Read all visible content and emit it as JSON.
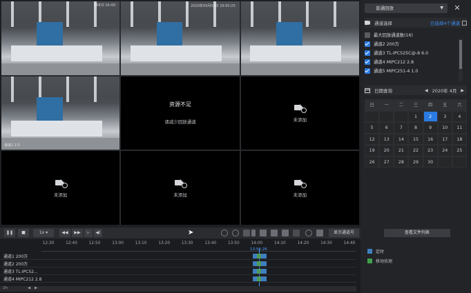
{
  "cells": [
    {
      "type": "video",
      "osd": "TRE/S 16:4D"
    },
    {
      "type": "video",
      "osd": "2020年04月02日 16:50:25"
    },
    {
      "type": "video",
      "osd": ""
    },
    {
      "type": "video",
      "stamp": "通道2 2.0"
    },
    {
      "type": "message",
      "title": "资源不足",
      "text": "请减少回放通道"
    },
    {
      "type": "empty",
      "text": "未添加"
    },
    {
      "type": "empty",
      "text": "未添加"
    },
    {
      "type": "empty",
      "text": "未添加"
    },
    {
      "type": "empty",
      "text": "未添加"
    }
  ],
  "side": {
    "mode_select": "普通回放",
    "channel_header": "通道选择",
    "selected_count": "已选择4个通道",
    "channels": [
      {
        "label": "最大回放通道数(16)",
        "checked": false
      },
      {
        "label": "通道2 200万",
        "checked": true
      },
      {
        "label": "通道3 TL-IPC525C@-8 6.0",
        "checked": true
      },
      {
        "label": "通道4 MIPC212 2.8",
        "checked": true
      },
      {
        "label": "通道5 MIPC251-4 1.0",
        "checked": true
      }
    ],
    "date_header": "日期查询",
    "month": "2020年 4月",
    "weekdays": [
      "日",
      "一",
      "二",
      "三",
      "四",
      "五",
      "六"
    ],
    "calendar": [
      [
        "",
        "",
        "",
        "1",
        "2",
        "3",
        "4"
      ],
      [
        "5",
        "6",
        "7",
        "8",
        "9",
        "10",
        "11"
      ],
      [
        "12",
        "13",
        "14",
        "15",
        "16",
        "17",
        "18"
      ],
      [
        "19",
        "20",
        "21",
        "22",
        "23",
        "24",
        "25"
      ],
      [
        "26",
        "27",
        "28",
        "29",
        "30",
        "",
        ""
      ]
    ],
    "today": "2",
    "file_list_button": "查看文件列表",
    "legend": [
      "定时",
      "移动侦测"
    ]
  },
  "controls": {
    "speed": "1x",
    "show_channel": "显示通道号"
  },
  "timeline": {
    "ticks": [
      "12:30",
      "12:40",
      "12:50",
      "13:00",
      "13:10",
      "13:20",
      "13:30",
      "13:40",
      "13:50",
      "14:00",
      "14:10",
      "14:20",
      "14:30",
      "14:40"
    ],
    "current_time": "13:56:26",
    "rows": [
      "通道1 200万",
      "通道2 200万",
      "通道3 TL-IPC52...",
      "通道4 MIPC212 2.8"
    ],
    "zoom": "2h"
  },
  "colors": {
    "accent": "#2a7be4",
    "record": "#3e7fbf",
    "motion": "#4f9b5a"
  }
}
